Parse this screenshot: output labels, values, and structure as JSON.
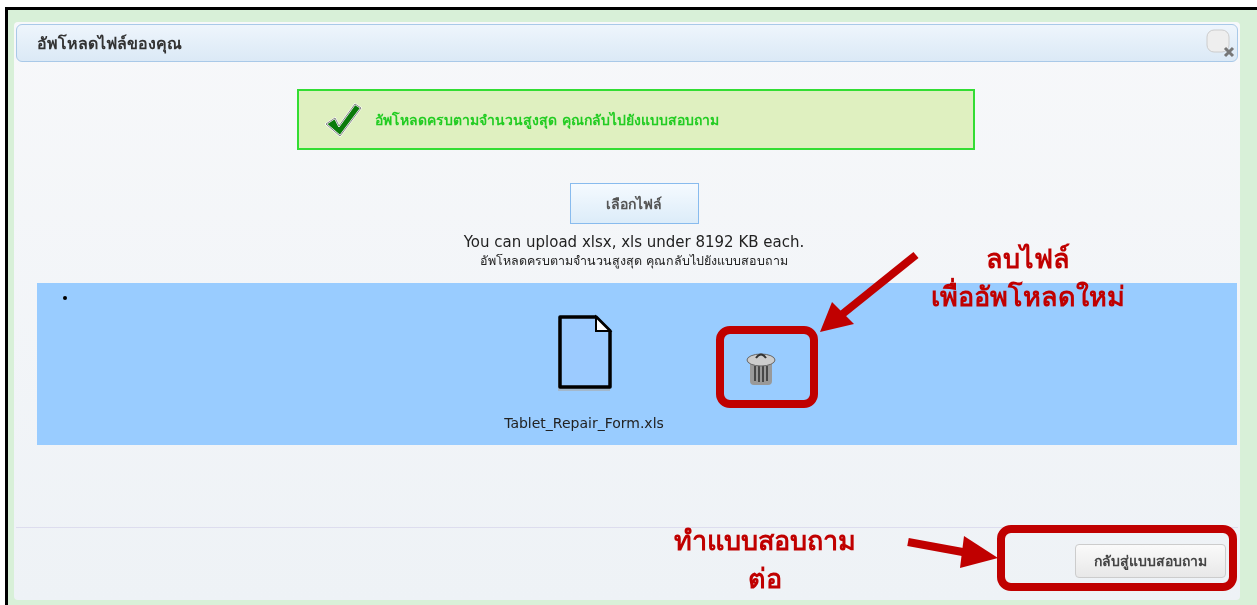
{
  "dialog": {
    "title": "อัพโหลดไฟล์ของคุณ",
    "success_message": "อัพโหลดครบตามจำนวนสูงสุด คุณกลับไปยังแบบสอบถาม",
    "choose_file_button": "เลือกไฟล์",
    "upload_hint": "You can upload xlsx, xls under 8192 KB each.",
    "status_text": "อัพโหลดครบตามจำนวนสูงสุด คุณกลับไปยังแบบสอบถาม",
    "files": [
      {
        "name": "Tablet_Repair_Form.xls"
      }
    ],
    "footer_button": "กลับสู่แบบสอบถาม"
  },
  "annotations": [
    {
      "kind": "delete",
      "text": "ลบไฟล์\nเพื่ออัพโหลดใหม่"
    },
    {
      "kind": "continue",
      "text": "ทำแบบสอบถาม\nต่อ"
    }
  ]
}
